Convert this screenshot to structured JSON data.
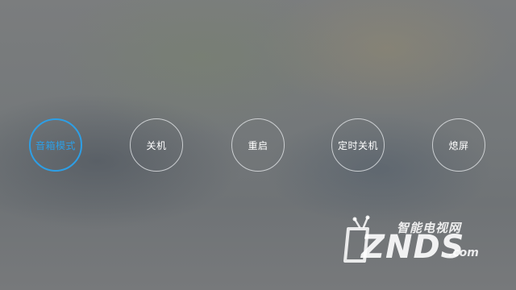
{
  "power_menu": {
    "options": [
      {
        "label": "音箱模式",
        "selected": true
      },
      {
        "label": "关机",
        "selected": false
      },
      {
        "label": "重启",
        "selected": false
      },
      {
        "label": "定时关机",
        "selected": false
      },
      {
        "label": "熄屏",
        "selected": false
      }
    ],
    "colors": {
      "selected": "#2d9fe6",
      "ring": "#ebeef0",
      "label": "#ffffff"
    }
  },
  "watermark": {
    "slogan": "智能电视网",
    "brand": "ZNDS",
    "domain": ".com",
    "icon": "tv-icon"
  }
}
